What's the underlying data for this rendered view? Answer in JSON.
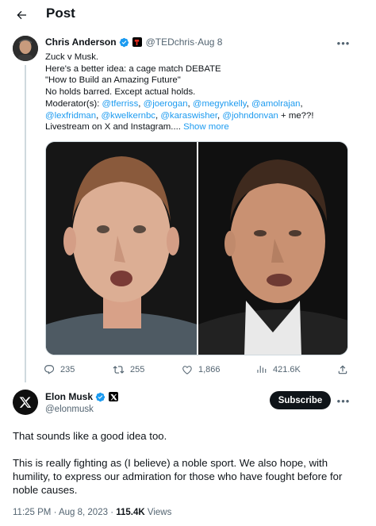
{
  "header": {
    "title": "Post"
  },
  "quoted_post": {
    "author_name": "Chris Anderson",
    "handle": "@TEDchris",
    "date": "Aug 8",
    "text": {
      "l1": "Zuck v Musk.",
      "l2": "Here's a better idea: a cage match DEBATE",
      "l3": "\"How to Build an Amazing Future\"",
      "l4": "No holds barred. Except actual holds.",
      "moderators_label": "Moderator(s):",
      "mentions": [
        "@tferriss",
        "@joerogan",
        "@megynkelly",
        "@amolrajan",
        "@lexfridman",
        "@kwelkernbc",
        "@karaswisher",
        "@johndonvan"
      ],
      "sep": ", ",
      "tail": " + me??!",
      "l7": "Livestream on X and Instagram....",
      "show_more": "Show more"
    },
    "stats": {
      "replies": "235",
      "reposts": "255",
      "likes": "1,866",
      "views": "421.6K"
    }
  },
  "post": {
    "author_name": "Elon Musk",
    "handle": "@elonmusk",
    "subscribe_label": "Subscribe",
    "p1": "That sounds like a good idea too.",
    "p2a": "This is really fighting as (I believe) a noble sport. We also hope, with",
    "p2b": "humility, to express our admiration for those who have fought before for",
    "p2c": "noble causes.",
    "time": "11:25 PM",
    "date": "Aug 8, 2023",
    "dot": " · ",
    "views_count": "115.4K",
    "views_label": " Views"
  },
  "icons": {
    "back": "arrow-left-icon",
    "verified": "verified-badge-icon",
    "more": "more-dots-icon",
    "reply": "reply-bubble-icon",
    "repost": "repost-icon",
    "like": "heart-icon",
    "views": "bar-chart-icon",
    "share": "share-upload-icon"
  },
  "colors": {
    "accent": "#1d9bf0",
    "text": "#0f1419",
    "muted": "#536471",
    "border": "#cfd9de"
  }
}
